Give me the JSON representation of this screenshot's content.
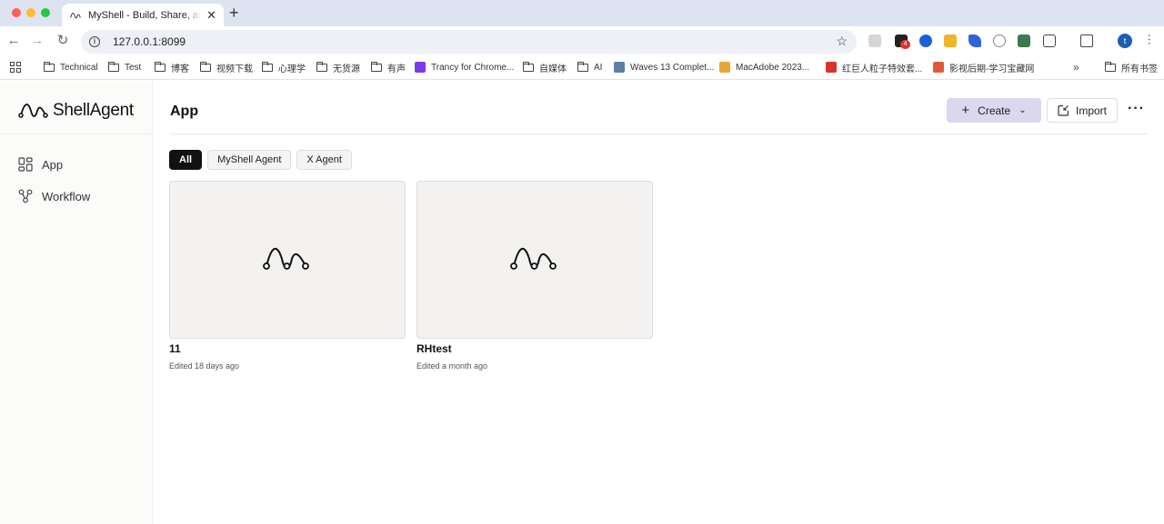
{
  "browser": {
    "tab_title": "MyShell - Build, Share, and Own AI Agents",
    "url": "127.0.0.1:8099",
    "extension_badge": "4",
    "profile_initial": "t",
    "bookmarks": [
      {
        "label": "Technical",
        "icon": "folder-icon"
      },
      {
        "label": "Test",
        "icon": "folder-icon"
      },
      {
        "label": "博客",
        "icon": "folder-icon"
      },
      {
        "label": "视频下载",
        "icon": "folder-icon"
      },
      {
        "label": "心理学",
        "icon": "folder-icon"
      },
      {
        "label": "无货源",
        "icon": "folder-icon"
      },
      {
        "label": "有声",
        "icon": "folder-icon"
      },
      {
        "label": "Trancy for Chrome...",
        "icon": "trancy-icon",
        "color": "#7c3aed"
      },
      {
        "label": "自媒体",
        "icon": "folder-icon"
      },
      {
        "label": "AI",
        "icon": "folder-icon"
      },
      {
        "label": "Waves 13 Complet...",
        "icon": "waves-icon",
        "color": "#5b7fa6"
      },
      {
        "label": "MacAdobe 2023...",
        "icon": "mac-icon",
        "color": "#e8a33b"
      },
      {
        "label": "红巨人粒子特效套...",
        "icon": "redgiant-icon",
        "color": "#d9342b"
      },
      {
        "label": "影视后期-学习宝藏网",
        "icon": "film-icon",
        "color": "#e05a3a"
      }
    ],
    "other_bookmarks": "所有书签"
  },
  "sidebar": {
    "logo_text": "ShellAgent",
    "items": [
      {
        "label": "App",
        "icon": "grid-icon"
      },
      {
        "label": "Workflow",
        "icon": "workflow-icon"
      }
    ]
  },
  "header": {
    "title": "App",
    "create_label": "Create",
    "import_label": "Import"
  },
  "filters": [
    "All",
    "MyShell Agent",
    "X Agent"
  ],
  "cards": [
    {
      "title": "11",
      "meta": "Edited 18 days ago"
    },
    {
      "title": "RHtest",
      "meta": "Edited a month ago"
    }
  ],
  "colors": {
    "create_button": "#dcd6ef",
    "active_chip": "#111111",
    "card_bg": "#f3f2f0"
  }
}
